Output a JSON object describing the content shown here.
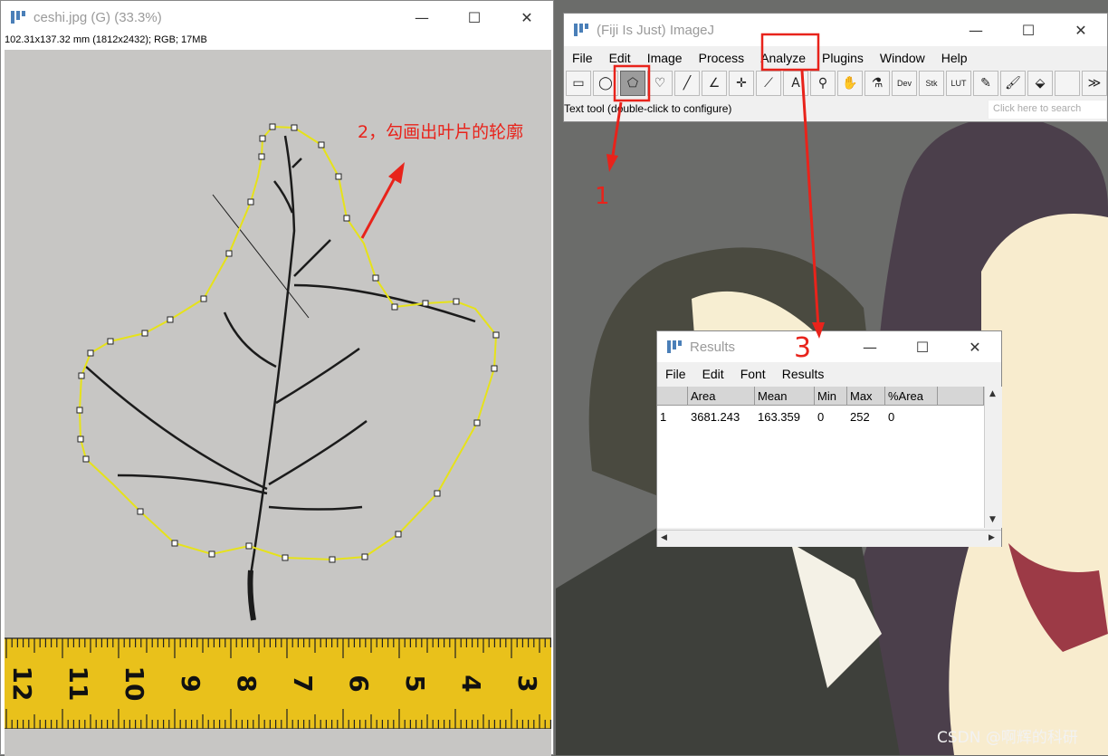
{
  "image_window": {
    "title": "ceshi.jpg (G) (33.3%)",
    "info": "102.31x137.32 mm (1812x2432); RGB; 17MB",
    "ruler_numbers": [
      "12",
      "11",
      "10",
      "9",
      "8",
      "7",
      "6",
      "5",
      "4",
      "3"
    ],
    "annotation": "2，勾画出叶片的轮廓"
  },
  "window_controls": {
    "minimize": "—",
    "maximize": "☐",
    "close": "✕"
  },
  "imagej": {
    "title": "(Fiji Is Just) ImageJ",
    "menu": [
      "File",
      "Edit",
      "Image",
      "Process",
      "Analyze",
      "Plugins",
      "Window",
      "Help"
    ],
    "tools": [
      {
        "icon": "rectangle-tool-icon",
        "glyph": "▭"
      },
      {
        "icon": "oval-tool-icon",
        "glyph": "◯"
      },
      {
        "icon": "polygon-tool-icon",
        "glyph": "⬠"
      },
      {
        "icon": "freehand-tool-icon",
        "glyph": "♡"
      },
      {
        "icon": "line-tool-icon",
        "glyph": "╱"
      },
      {
        "icon": "angle-tool-icon",
        "glyph": "∠"
      },
      {
        "icon": "point-tool-icon",
        "glyph": "✛"
      },
      {
        "icon": "wand-tool-icon",
        "glyph": "⟋"
      },
      {
        "icon": "text-tool-icon",
        "glyph": "A"
      },
      {
        "icon": "zoom-tool-icon",
        "glyph": "⚲"
      },
      {
        "icon": "hand-tool-icon",
        "glyph": "✋"
      },
      {
        "icon": "dropper-tool-icon",
        "glyph": "⚗"
      },
      {
        "icon": "dev-menu-icon",
        "glyph": "Dev"
      },
      {
        "icon": "stk-menu-icon",
        "glyph": "Stk"
      },
      {
        "icon": "lut-menu-icon",
        "glyph": "LUT"
      },
      {
        "icon": "pencil-tool-icon",
        "glyph": "✎"
      },
      {
        "icon": "brush-tool-icon",
        "glyph": "🖌"
      },
      {
        "icon": "flood-fill-tool-icon",
        "glyph": "⬙"
      },
      {
        "icon": "blank-tool-icon",
        "glyph": ""
      },
      {
        "icon": "more-tools-icon",
        "glyph": "≫"
      }
    ],
    "selected_tool_index": 2,
    "status": "Text tool (double-click to configure)",
    "search_placeholder": "Click here to search",
    "annotation_1": "1",
    "annotation_3": "3"
  },
  "results": {
    "title": "Results",
    "menu": [
      "File",
      "Edit",
      "Font",
      "Results"
    ],
    "columns": [
      "",
      "Area",
      "Mean",
      "Min",
      "Max",
      "%Area"
    ],
    "rows": [
      [
        "1",
        "3681.243",
        "163.359",
        "0",
        "252",
        "0"
      ]
    ]
  },
  "watermark": "CSDN @啊辉的科研",
  "colors": {
    "annotation_red": "#e8231b",
    "outline_yellow": "#e6e21a",
    "ruler_yellow": "#e9c11b"
  }
}
